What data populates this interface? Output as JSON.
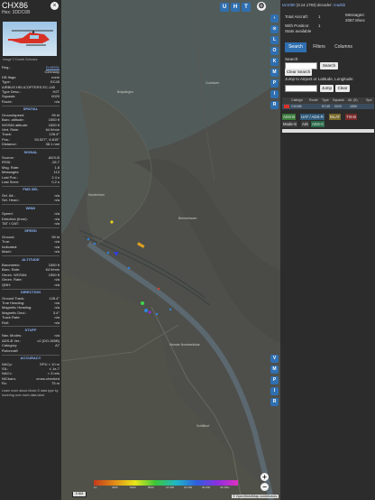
{
  "aircraft": {
    "callsign": "CHX86",
    "hex_line": "Hex: 3DDC6B",
    "close": "×",
    "photo_caption": "Image © Daniel Schwarz"
  },
  "details_top": [
    {
      "k": "Reg.:",
      "v": "D-HDSL",
      "link": true
    },
    {
      "k": "",
      "v": "Germany"
    },
    {
      "k": "DB flags:",
      "v": "none"
    },
    {
      "k": "Type:",
      "v": "EC45"
    },
    {
      "k": "AIRBUS HELICOPTERS EC-145",
      "v": ""
    },
    {
      "k": "Type Desc.:",
      "v": "H2T"
    },
    {
      "k": "Squawk:",
      "v": "0020"
    },
    {
      "k": "Route:",
      "v": "n/a"
    }
  ],
  "sections": [
    {
      "title": "SPATIAL",
      "rows": [
        {
          "k": "Groundspeed:",
          "v": "99 kt"
        },
        {
          "k": "Baro. altitude:",
          "v": "1550 ft"
        },
        {
          "k": "WGS84 altitude:",
          "v": "1550 ft"
        },
        {
          "k": "Vert. Rate:",
          "v": "64 ft/min"
        },
        {
          "k": "Track:",
          "v": "128.4°"
        },
        {
          "k": "Pos.:",
          "v": "53.527°, 8.815°"
        },
        {
          "k": "Distance:",
          "v": "38.1 nmi"
        }
      ]
    },
    {
      "title": "SIGNAL",
      "rows": [
        {
          "k": "Source:",
          "v": "ADS-B"
        },
        {
          "k": "RSSI:",
          "v": "-26.7"
        },
        {
          "k": "Msg. Rate:",
          "v": "1.8"
        },
        {
          "k": "Messages:",
          "v": "113"
        },
        {
          "k": "Last Pos.:",
          "v": "2.4 s"
        },
        {
          "k": "Last Seen:",
          "v": "0.2 s"
        }
      ]
    },
    {
      "title": "FMS SEL",
      "rows": [
        {
          "k": "Sel. Alt.:",
          "v": "n/a"
        },
        {
          "k": "Sel. Head.:",
          "v": "n/a"
        }
      ]
    },
    {
      "title": "WIND",
      "rows": [
        {
          "k": "Speed:",
          "v": "n/a"
        },
        {
          "k": "Direction (from):",
          "v": "n/a"
        },
        {
          "k": "TAT / OAT:",
          "v": "n/a"
        }
      ]
    },
    {
      "title": "SPEED",
      "rows": [
        {
          "k": "Ground:",
          "v": "99 kt"
        },
        {
          "k": "True:",
          "v": "n/a"
        },
        {
          "k": "Indicated:",
          "v": "n/a"
        },
        {
          "k": "Mach:",
          "v": "n/a"
        }
      ]
    },
    {
      "title": "ALTITUDE",
      "rows": [
        {
          "k": "Barometric:",
          "v": "1550 ft"
        },
        {
          "k": "Baro. Rate:",
          "v": "64 ft/min"
        },
        {
          "k": "Geom. WGS84:",
          "v": "1550 ft"
        },
        {
          "k": "Geom. Rate:",
          "v": "n/a"
        },
        {
          "k": "QNH:",
          "v": "n/a"
        }
      ]
    },
    {
      "title": "DIRECTION",
      "rows": [
        {
          "k": "Ground Track:",
          "v": "128.4°"
        },
        {
          "k": "True Heading:",
          "v": "n/a"
        },
        {
          "k": "Magnetic Heading:",
          "v": "n/a"
        },
        {
          "k": "Magnetic Decl.:",
          "v": "3.4°"
        },
        {
          "k": "Track Rate:",
          "v": "n/a"
        },
        {
          "k": "Roll:",
          "v": "n/a"
        }
      ]
    },
    {
      "title": "STUFF",
      "rows": [
        {
          "k": "Nav. Modes:",
          "v": "n/a"
        },
        {
          "k": "ADS-B Ver.:",
          "v": "v2 (DO-260B)"
        },
        {
          "k": "Category:",
          "v": "A7"
        },
        {
          "k": "Rotorcraft",
          "v": ""
        }
      ]
    },
    {
      "title": "ACCURACY",
      "rows": [
        {
          "k": "NACp:",
          "v": "EPU < 10 m"
        },
        {
          "k": "SIL:",
          "v": "≤ 1e-7"
        },
        {
          "k": "NACv:",
          "v": "< 3 m/s"
        },
        {
          "k": "NICbaro:",
          "v": "cross-checked"
        },
        {
          "k": "Rc:",
          "v": "75 m"
        }
      ]
    }
  ],
  "footnote": "Learn more about Mode-S data type by hovering over each data label.",
  "map": {
    "top_buttons": [
      "U",
      "H",
      "T"
    ],
    "side_buttons": [
      "‹",
      "⊙",
      "L",
      "O",
      "K",
      "M",
      "P",
      "I",
      "R"
    ],
    "right_side_buttons": [
      "V",
      "M",
      "P",
      "I",
      "R"
    ],
    "labels": [
      {
        "text": "Butjadingen",
        "pos": "a"
      },
      {
        "text": "Nordenham",
        "pos": "b"
      },
      {
        "text": "Cuxhaven",
        "pos": "c"
      },
      {
        "text": "Bremerhaven",
        "pos": "d"
      },
      {
        "text": "Wurster Nordseeküste",
        "pos": "e"
      },
      {
        "text": "Schiffdorf",
        "pos": "f"
      }
    ],
    "zoom_in": "+",
    "zoom_out": "−",
    "scale": "5 NM",
    "alt_legend": [
      "FL",
      "4000",
      "6000",
      "8000",
      "10 000",
      "20 000",
      "30 000",
      "40 000+"
    ],
    "attribution": "© OpenStreetMap contributors."
  },
  "right": {
    "title_link": "tar1090",
    "version": "(3.14.1793)",
    "decoder_label": "decoder:",
    "decoder_link": "readsb",
    "total_aircraft_label": "Total Aircraft:",
    "total_aircraft": "1",
    "messages_label": "Messages:",
    "messages": "2087.8/sec",
    "with_position_label": "With Position:",
    "with_position": "1",
    "stats_label": "Stats available",
    "tabs": [
      "Search",
      "Filters",
      "Columns"
    ],
    "search_label": "Search:",
    "search_button": "Search",
    "clear_search": "Clear Search",
    "jump_label": "Jump to Airport or Latitude, Longitude:",
    "jump_button": "Jump",
    "clear_button": "Clear",
    "table_headers": [
      "Callsign",
      "Route",
      "Type",
      "Squawk",
      "Alt. (ft)",
      "Spd"
    ],
    "table_row": [
      "CHX86",
      "",
      "EC45",
      "0020",
      "1550",
      ""
    ],
    "legend": [
      {
        "text": "ADS-B",
        "color": "#3a7a3a"
      },
      {
        "text": "UAT / ADS-R",
        "color": "#2f5a7a"
      },
      {
        "text": "MLAT",
        "color": "#7a6a2a"
      },
      {
        "text": "TIS-B",
        "color": "#7a2a2a"
      },
      {
        "text": "Mode-S",
        "color": "#3c3c3c"
      },
      {
        "text": "AIS",
        "color": "#3c3c3c"
      },
      {
        "text": "ADS-C",
        "color": "#2a6a4a"
      }
    ]
  }
}
